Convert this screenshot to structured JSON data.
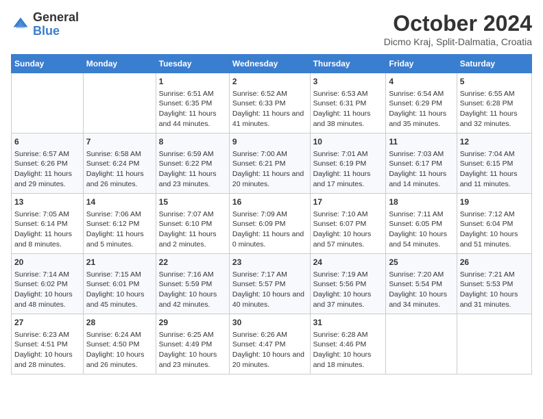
{
  "header": {
    "logo_general": "General",
    "logo_blue": "Blue",
    "month_title": "October 2024",
    "location": "Dicmo Kraj, Split-Dalmatia, Croatia"
  },
  "days_of_week": [
    "Sunday",
    "Monday",
    "Tuesday",
    "Wednesday",
    "Thursday",
    "Friday",
    "Saturday"
  ],
  "weeks": [
    [
      {
        "day": "",
        "detail": ""
      },
      {
        "day": "",
        "detail": ""
      },
      {
        "day": "1",
        "detail": "Sunrise: 6:51 AM\nSunset: 6:35 PM\nDaylight: 11 hours and 44 minutes."
      },
      {
        "day": "2",
        "detail": "Sunrise: 6:52 AM\nSunset: 6:33 PM\nDaylight: 11 hours and 41 minutes."
      },
      {
        "day": "3",
        "detail": "Sunrise: 6:53 AM\nSunset: 6:31 PM\nDaylight: 11 hours and 38 minutes."
      },
      {
        "day": "4",
        "detail": "Sunrise: 6:54 AM\nSunset: 6:29 PM\nDaylight: 11 hours and 35 minutes."
      },
      {
        "day": "5",
        "detail": "Sunrise: 6:55 AM\nSunset: 6:28 PM\nDaylight: 11 hours and 32 minutes."
      }
    ],
    [
      {
        "day": "6",
        "detail": "Sunrise: 6:57 AM\nSunset: 6:26 PM\nDaylight: 11 hours and 29 minutes."
      },
      {
        "day": "7",
        "detail": "Sunrise: 6:58 AM\nSunset: 6:24 PM\nDaylight: 11 hours and 26 minutes."
      },
      {
        "day": "8",
        "detail": "Sunrise: 6:59 AM\nSunset: 6:22 PM\nDaylight: 11 hours and 23 minutes."
      },
      {
        "day": "9",
        "detail": "Sunrise: 7:00 AM\nSunset: 6:21 PM\nDaylight: 11 hours and 20 minutes."
      },
      {
        "day": "10",
        "detail": "Sunrise: 7:01 AM\nSunset: 6:19 PM\nDaylight: 11 hours and 17 minutes."
      },
      {
        "day": "11",
        "detail": "Sunrise: 7:03 AM\nSunset: 6:17 PM\nDaylight: 11 hours and 14 minutes."
      },
      {
        "day": "12",
        "detail": "Sunrise: 7:04 AM\nSunset: 6:15 PM\nDaylight: 11 hours and 11 minutes."
      }
    ],
    [
      {
        "day": "13",
        "detail": "Sunrise: 7:05 AM\nSunset: 6:14 PM\nDaylight: 11 hours and 8 minutes."
      },
      {
        "day": "14",
        "detail": "Sunrise: 7:06 AM\nSunset: 6:12 PM\nDaylight: 11 hours and 5 minutes."
      },
      {
        "day": "15",
        "detail": "Sunrise: 7:07 AM\nSunset: 6:10 PM\nDaylight: 11 hours and 2 minutes."
      },
      {
        "day": "16",
        "detail": "Sunrise: 7:09 AM\nSunset: 6:09 PM\nDaylight: 11 hours and 0 minutes."
      },
      {
        "day": "17",
        "detail": "Sunrise: 7:10 AM\nSunset: 6:07 PM\nDaylight: 10 hours and 57 minutes."
      },
      {
        "day": "18",
        "detail": "Sunrise: 7:11 AM\nSunset: 6:05 PM\nDaylight: 10 hours and 54 minutes."
      },
      {
        "day": "19",
        "detail": "Sunrise: 7:12 AM\nSunset: 6:04 PM\nDaylight: 10 hours and 51 minutes."
      }
    ],
    [
      {
        "day": "20",
        "detail": "Sunrise: 7:14 AM\nSunset: 6:02 PM\nDaylight: 10 hours and 48 minutes."
      },
      {
        "day": "21",
        "detail": "Sunrise: 7:15 AM\nSunset: 6:01 PM\nDaylight: 10 hours and 45 minutes."
      },
      {
        "day": "22",
        "detail": "Sunrise: 7:16 AM\nSunset: 5:59 PM\nDaylight: 10 hours and 42 minutes."
      },
      {
        "day": "23",
        "detail": "Sunrise: 7:17 AM\nSunset: 5:57 PM\nDaylight: 10 hours and 40 minutes."
      },
      {
        "day": "24",
        "detail": "Sunrise: 7:19 AM\nSunset: 5:56 PM\nDaylight: 10 hours and 37 minutes."
      },
      {
        "day": "25",
        "detail": "Sunrise: 7:20 AM\nSunset: 5:54 PM\nDaylight: 10 hours and 34 minutes."
      },
      {
        "day": "26",
        "detail": "Sunrise: 7:21 AM\nSunset: 5:53 PM\nDaylight: 10 hours and 31 minutes."
      }
    ],
    [
      {
        "day": "27",
        "detail": "Sunrise: 6:23 AM\nSunset: 4:51 PM\nDaylight: 10 hours and 28 minutes."
      },
      {
        "day": "28",
        "detail": "Sunrise: 6:24 AM\nSunset: 4:50 PM\nDaylight: 10 hours and 26 minutes."
      },
      {
        "day": "29",
        "detail": "Sunrise: 6:25 AM\nSunset: 4:49 PM\nDaylight: 10 hours and 23 minutes."
      },
      {
        "day": "30",
        "detail": "Sunrise: 6:26 AM\nSunset: 4:47 PM\nDaylight: 10 hours and 20 minutes."
      },
      {
        "day": "31",
        "detail": "Sunrise: 6:28 AM\nSunset: 4:46 PM\nDaylight: 10 hours and 18 minutes."
      },
      {
        "day": "",
        "detail": ""
      },
      {
        "day": "",
        "detail": ""
      }
    ]
  ]
}
